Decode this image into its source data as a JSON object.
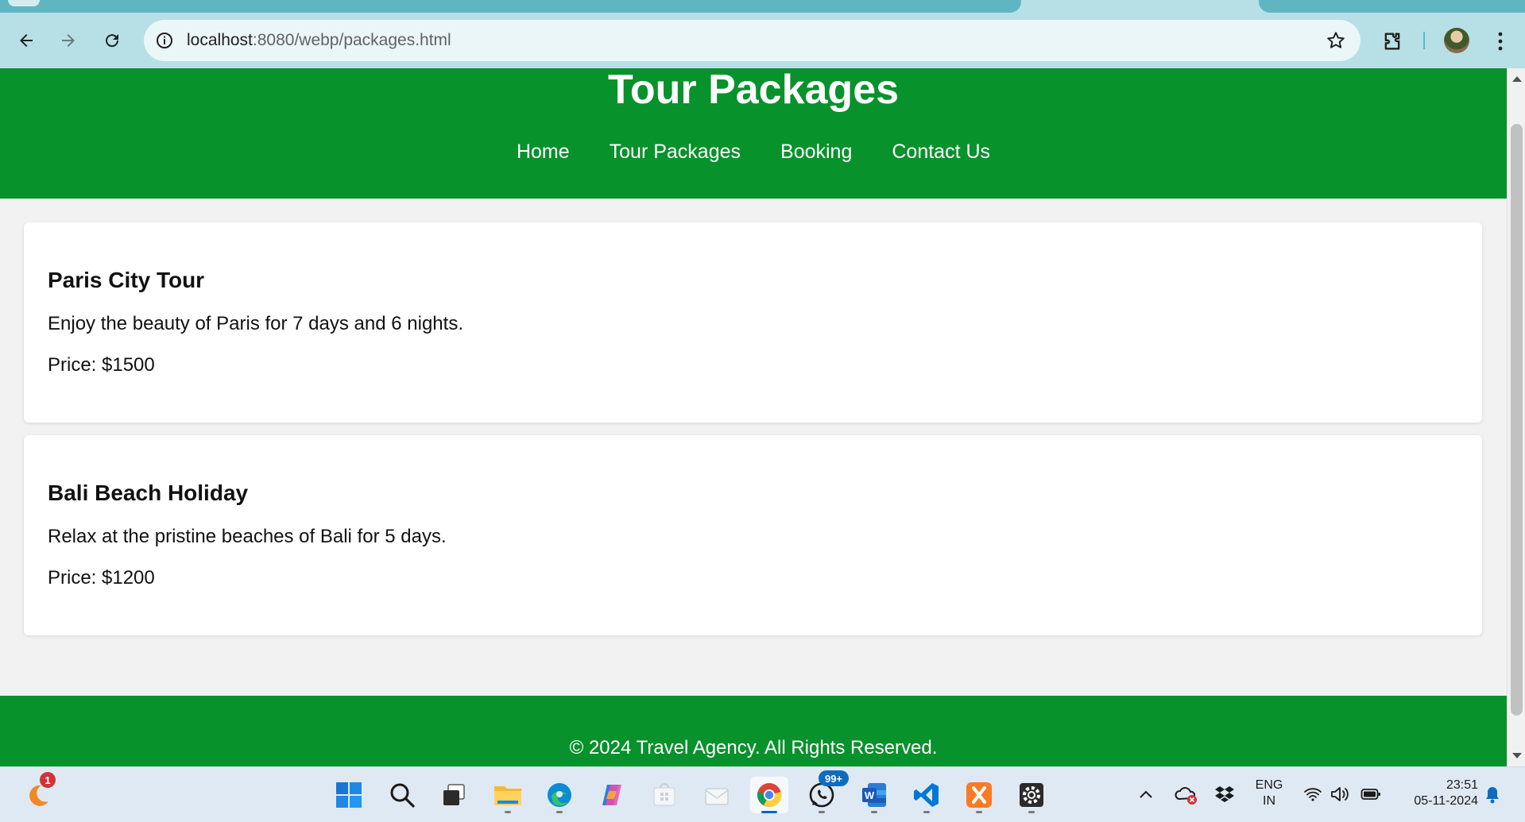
{
  "browser": {
    "url_host": "localhost",
    "url_path": ":8080/webp/packages.html"
  },
  "site": {
    "title": "Tour Packages",
    "nav": [
      "Home",
      "Tour Packages",
      "Booking",
      "Contact Us"
    ],
    "packages": [
      {
        "name": "Paris City Tour",
        "description": "Enjoy the beauty of Paris for 7 days and 6 nights.",
        "price": "Price: $1500"
      },
      {
        "name": "Bali Beach Holiday",
        "description": "Relax at the pristine beaches of Bali for 5 days.",
        "price": "Price: $1200"
      }
    ],
    "footer": "© 2024 Travel Agency. All Rights Reserved."
  },
  "taskbar": {
    "weather_badge": "1",
    "whatsapp_badge": "99+",
    "language_line1": "ENG",
    "language_line2": "IN",
    "time": "23:51",
    "date": "05-11-2024"
  },
  "colors": {
    "header_green": "#07922b",
    "chrome_teal": "#b6e0e6"
  }
}
